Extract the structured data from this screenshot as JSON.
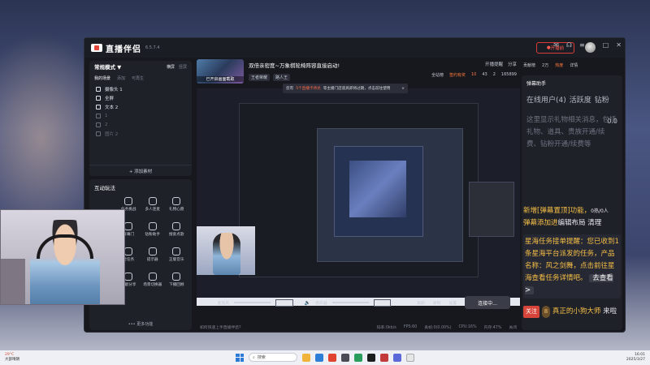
{
  "app": {
    "name": "直播伴侣",
    "version": "6.5.7.4",
    "live_button": "开播前",
    "toolbar_right": [
      "贡献榜",
      "2万",
      "热度",
      "详情"
    ]
  },
  "scenes": {
    "mode": "常规模式",
    "mode_arrow": "▼",
    "header_right": [
      "横屏",
      "竖屏"
    ],
    "tabs": [
      "我的场景",
      "添加",
      "可再生"
    ],
    "items": [
      {
        "label": "摄像头 1",
        "dim": false
      },
      {
        "label": "全屏",
        "dim": false
      },
      {
        "label": "文本 2",
        "dim": false
      },
      {
        "label": "1",
        "dim": true
      },
      {
        "label": "2",
        "dim": true
      },
      {
        "label": "图片 2",
        "dim": true
      }
    ],
    "add_label": "+ 添加素材"
  },
  "interact": {
    "title": "互动玩法",
    "tools": [
      {
        "label": "",
        "hidden": true
      },
      {
        "label": "任务挑战",
        "hidden": false
      },
      {
        "label": "多人连麦",
        "hidden": false
      },
      {
        "label": "礼物心愿",
        "hidden": false
      },
      {
        "label": "",
        "hidden": true
      },
      {
        "label": "屏幕门",
        "hidden": false
      },
      {
        "label": "钻粉助手",
        "hidden": false
      },
      {
        "label": "搜索点歌",
        "hidden": false
      },
      {
        "label": "",
        "hidden": true
      },
      {
        "label": "星任务",
        "hidden": false
      },
      {
        "label": "提示器",
        "hidden": false
      },
      {
        "label": "正版音乐",
        "hidden": false
      },
      {
        "label": "弹幕秀",
        "hidden": false
      },
      {
        "label": "贡献分享",
        "hidden": false
      },
      {
        "label": "场景切换器",
        "hidden": false
      },
      {
        "label": "下播回顾",
        "hidden": false
      }
    ],
    "more": "更多功能"
  },
  "stream": {
    "cover_label": "已开启画面截取",
    "title": "双倍亲密度~万象棋轮椅阵容直接启动!",
    "tags": [
      "王者荣耀",
      "路人王"
    ],
    "top_mini": [
      "开播提醒",
      "分享"
    ],
    "stats": [
      "全站榜",
      "签约有奖",
      "10",
      "43",
      "2",
      "165899"
    ]
  },
  "tooltip": {
    "prefix": "您有",
    "link": "5个直播卡待兑",
    "suffix": "等主播门店道具即将过期，点击前往使用",
    "close": "×"
  },
  "audio": {
    "mic_label": "麦克风",
    "mic_pct": "100%",
    "mic_level": 100,
    "speaker_label": "扬声器",
    "speaker_pct": "100%",
    "speaker_level": 100,
    "controls": [
      "美颜",
      "录制",
      "设置"
    ],
    "connect": "连接中..."
  },
  "statusbar": [
    "如何快速上手直播伴侣?",
    "码率:0kb/s",
    "FPS:60",
    "丢帧:0(0.00%)",
    "CPU:16%",
    "内存:47%",
    "关闭"
  ],
  "danmu": {
    "title": "弹幕助手",
    "online": "在线用户(4)",
    "active": "活跃度",
    "diamond": "钻粉",
    "stat_value": "0.0",
    "notice": "这里显示礼物相关消息，包括礼物、道具、贵族开通/续费、钻粉开通/续费等",
    "msg1_prefix": "新增[弹幕置顶]功能，",
    "msg1_suffix": "0热/0人",
    "msg1b_prefix": "弹幕添加进",
    "msg1b_suffix": "编辑布局  清理",
    "msg2": "星海任务接单提醒：您已收到1条星海平台派发的任务，产品名称：风之剑舞，点击前往星海查看任务详情吧。",
    "msg2_btn": "去查看 >",
    "fan_badge": "关注",
    "level_badge": "8",
    "user": "真正的小狗大师",
    "user_msg": "来啦"
  },
  "taskbar": {
    "weather_temp": "29°C",
    "weather_desc": "大部晴朗",
    "search": "搜索",
    "time": "16:01",
    "date": "2025/3/27"
  }
}
